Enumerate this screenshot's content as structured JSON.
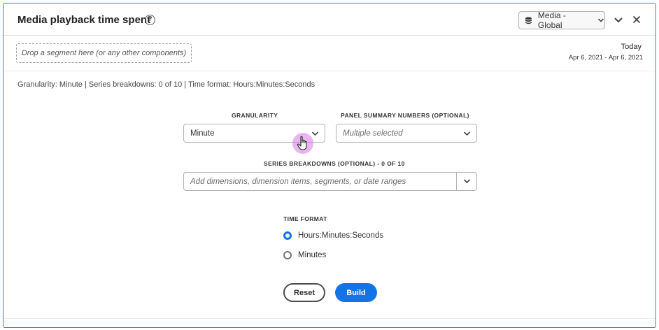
{
  "panel": {
    "title": "Media playback time spent",
    "help_glyph": "?",
    "report_suite": "Media - Global",
    "accent_color": "#2680eb"
  },
  "segment_bar": {
    "drop_zone_text": "Drop a segment here (or any other components)",
    "date_label": "Today",
    "date_range": "Apr 6, 2021 - Apr 6, 2021"
  },
  "summary": {
    "text": "Granularity: Minute |  Series breakdowns: 0 of 10  | Time format: Hours:Minutes:Seconds"
  },
  "form": {
    "granularity": {
      "label": "GRANULARITY",
      "value": "Minute"
    },
    "panel_summary": {
      "label": "PANEL SUMMARY NUMBERS (OPTIONAL)",
      "placeholder": "Multiple selected"
    },
    "series_breakdowns": {
      "label": "SERIES BREAKDOWNS (OPTIONAL) - 0 OF 10",
      "placeholder": "Add dimensions, dimension items, segments, or date ranges"
    },
    "time_format": {
      "label": "TIME FORMAT",
      "options": [
        {
          "label": "Hours:Minutes:Seconds",
          "selected": true
        },
        {
          "label": "Minutes",
          "selected": false
        }
      ]
    }
  },
  "actions": {
    "reset_label": "Reset",
    "build_label": "Build",
    "build_color": "#1473e6"
  },
  "icons": [
    "help-icon",
    "database-icon",
    "chevron-down-icon",
    "collapse-icon",
    "close-icon",
    "hand-cursor-icon"
  ]
}
